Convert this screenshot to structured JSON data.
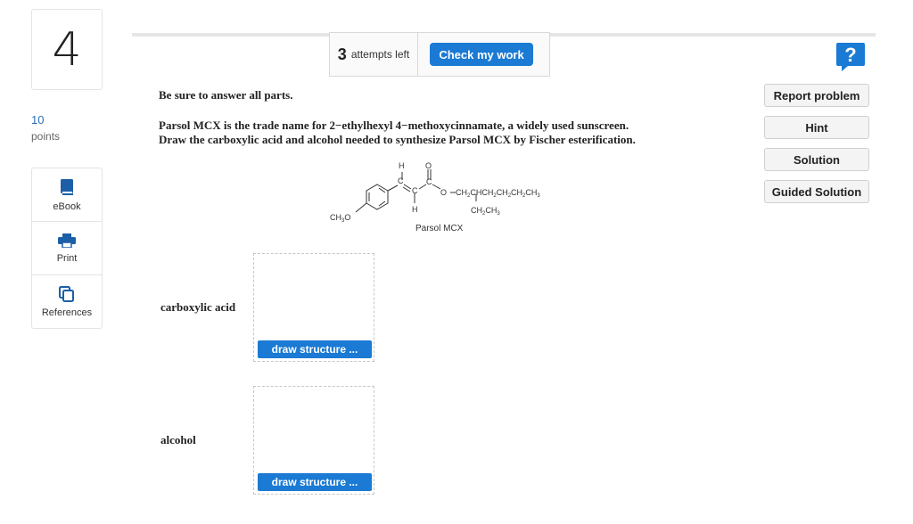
{
  "question": {
    "number": "4",
    "points_value": "10",
    "points_label": "points"
  },
  "resources": [
    {
      "label": "eBook",
      "icon": "book-icon"
    },
    {
      "label": "Print",
      "icon": "printer-icon"
    },
    {
      "label": "References",
      "icon": "copy-icon"
    }
  ],
  "toolbar": {
    "attempts_count": "3",
    "attempts_label": "attempts left",
    "check_label": "Check my work",
    "help_symbol": "?"
  },
  "side_buttons": {
    "report": "Report problem",
    "hint": "Hint",
    "solution": "Solution",
    "guided": "Guided Solution"
  },
  "content": {
    "instruction": "Be sure to answer all parts.",
    "line1": "Parsol MCX is the trade name for 2−ethylhexyl 4−methoxycinnamate, a widely used sunscreen.",
    "line2": "Draw the carboxylic acid and alcohol needed to synthesize Parsol MCX by Fischer esterification.",
    "molecule_name": "Parsol MCX"
  },
  "answers": [
    {
      "label": "carboxylic acid",
      "button": "draw structure ..."
    },
    {
      "label": "alcohol",
      "button": "draw structure ..."
    }
  ],
  "colors": {
    "accent": "#1a7ad4",
    "points": "#2a6fb4"
  }
}
